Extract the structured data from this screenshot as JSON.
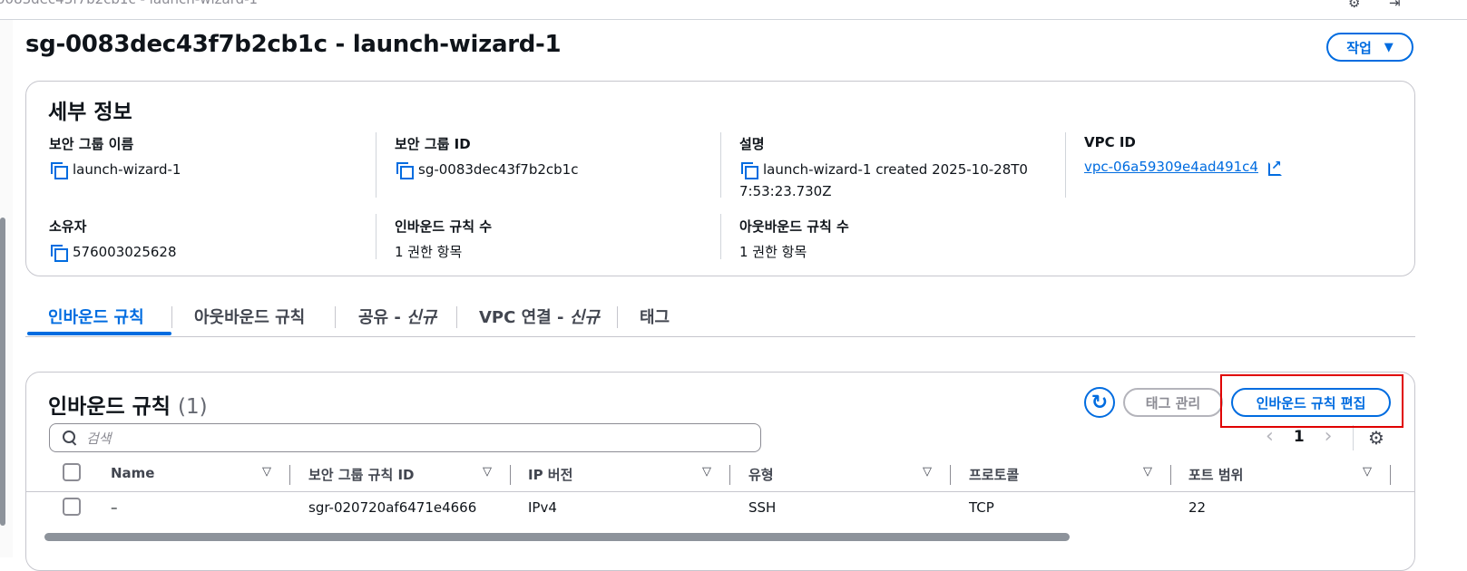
{
  "topbar": {
    "crumb": "0083dec43f7b2cb1c - launch-wizard-1"
  },
  "page": {
    "title": "sg-0083dec43f7b2cb1c - launch-wizard-1",
    "actions_label": "작업"
  },
  "details": {
    "title": "세부 정보",
    "sg_name_label": "보안 그룹 이름",
    "sg_name": "launch-wizard-1",
    "sg_id_label": "보안 그룹 ID",
    "sg_id": "sg-0083dec43f7b2cb1c",
    "desc_label": "설명",
    "desc_line1": "launch-wizard-1 created 2025-10-28T0",
    "desc_line2": "7:53:23.730Z",
    "vpc_label": "VPC ID",
    "vpc_id": "vpc-06a59309e4ad491c4",
    "owner_label": "소유자",
    "owner": "576003025628",
    "inbound_count_label": "인바운드 규칙 수",
    "inbound_count": "1 권한 항목",
    "outbound_count_label": "아웃바운드 규칙 수",
    "outbound_count": "1 권한 항목"
  },
  "tabs": {
    "inbound": "인바운드 규칙",
    "outbound": "아웃바운드 규칙",
    "share_main": "공유 - ",
    "share_new": "신규",
    "vpc_main": "VPC 연결 - ",
    "vpc_new": "신규",
    "tags": "태그"
  },
  "inbound_panel": {
    "title": "인바운드 규칙",
    "count": "(1)",
    "manage_tags_label": "태그 관리",
    "edit_label": "인바운드 규칙 편집",
    "search_placeholder": "검색",
    "page_number": "1",
    "columns": [
      "Name",
      "보안 그룹 규칙 ID",
      "IP 버전",
      "유형",
      "프로토콜",
      "포트 범위"
    ],
    "rows": [
      {
        "name": "–",
        "rule_id": "sgr-020720af6471e4666",
        "ip_version": "IPv4",
        "type": "SSH",
        "protocol": "TCP",
        "port_range": "22"
      }
    ]
  }
}
